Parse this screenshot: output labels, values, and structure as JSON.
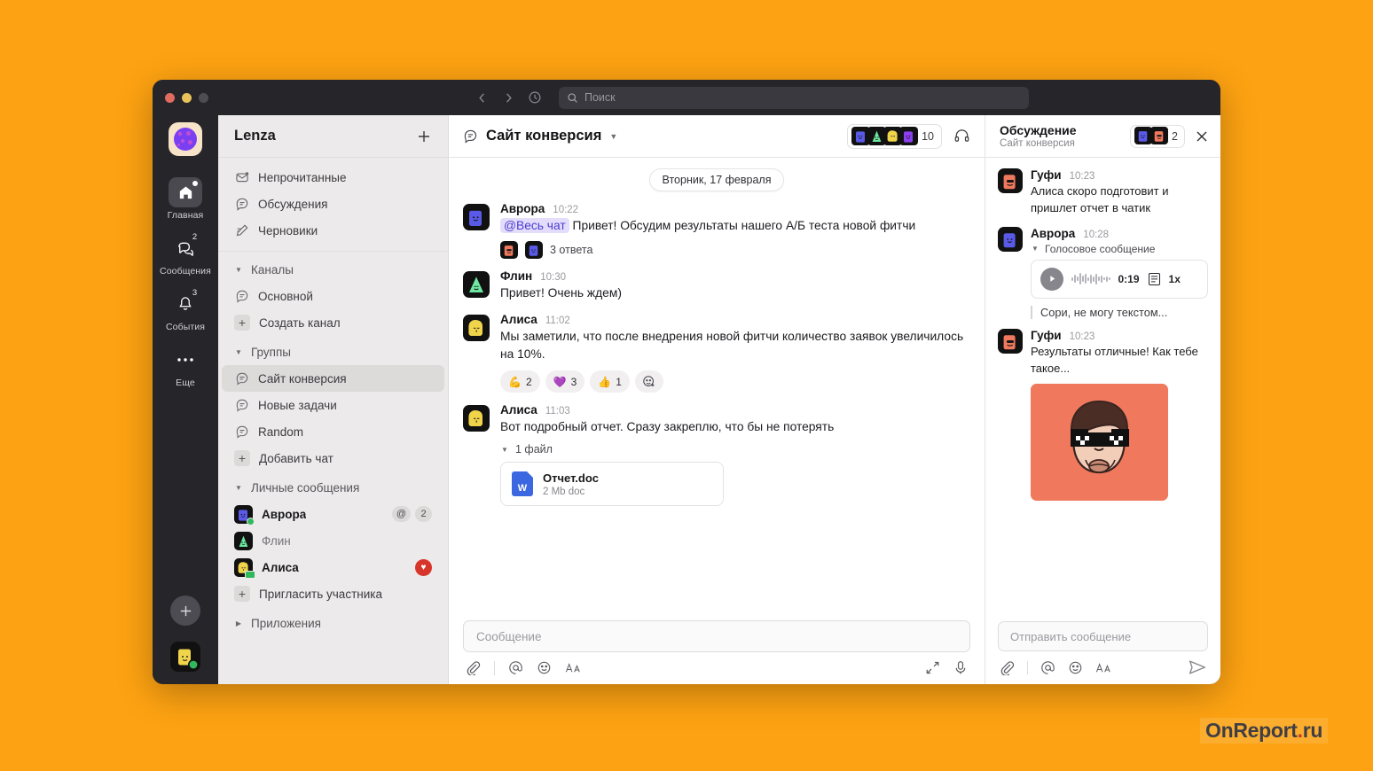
{
  "window": {
    "traffic_lights": [
      "close",
      "minimize",
      "maximize"
    ],
    "search": {
      "placeholder": "Поиск",
      "icon": "search-icon"
    },
    "nav": {
      "back": "chevron-left-icon",
      "forward": "chevron-right-icon",
      "history": "clock-icon"
    }
  },
  "rail": {
    "workspace_logo": "cookie-logo",
    "items": [
      {
        "label": "Главная",
        "icon": "home-icon",
        "badge": "",
        "active": true,
        "dot": true
      },
      {
        "label": "Сообщения",
        "icon": "chat-bubbles-icon",
        "badge": "2",
        "active": false,
        "dot": false
      },
      {
        "label": "События",
        "icon": "bell-icon",
        "badge": "3",
        "active": false,
        "dot": false
      },
      {
        "label": "Еще",
        "icon": "ellipsis-icon",
        "badge": "",
        "active": false,
        "dot": false
      }
    ],
    "add_button": "+",
    "me_avatar": "yellow-avatar"
  },
  "sidebar": {
    "title": "Lenza",
    "add_label": "+",
    "top_items": [
      {
        "label": "Непрочитанные",
        "icon": "envelope-icon"
      },
      {
        "label": "Обсуждения",
        "icon": "thread-icon"
      },
      {
        "label": "Черновики",
        "icon": "draft-pencil-icon"
      }
    ],
    "groups": [
      {
        "name": "Каналы",
        "expanded": true,
        "items": [
          {
            "label": "Основной",
            "icon": "channel-icon",
            "selected": false
          }
        ],
        "action": {
          "label": "Создать канал",
          "icon": "plus-box-icon"
        }
      },
      {
        "name": "Группы",
        "expanded": true,
        "items": [
          {
            "label": "Сайт конверсия",
            "icon": "channel-icon",
            "selected": true
          },
          {
            "label": "Новые задачи",
            "icon": "channel-icon",
            "selected": false
          },
          {
            "label": "Random",
            "icon": "channel-icon",
            "selected": false
          }
        ],
        "action": {
          "label": "Добавить чат",
          "icon": "plus-box-icon"
        }
      },
      {
        "name": "Личные сообщения",
        "expanded": true,
        "dms": [
          {
            "label": "Аврора",
            "unread": true,
            "mention": "@",
            "count": "2",
            "status": "online",
            "color": "#5a5ae8"
          },
          {
            "label": "Флин",
            "unread": false,
            "mention": "",
            "count": "",
            "status": "none",
            "color": "#6ee7a0"
          },
          {
            "label": "Алиса",
            "unread": true,
            "mention": "",
            "count": "",
            "status": "camera",
            "badge": "heart",
            "color": "#f0d44a"
          }
        ],
        "action": {
          "label": "Пригласить участника",
          "icon": "plus-box-icon"
        }
      }
    ],
    "apps": {
      "name": "Приложения",
      "expanded": false
    }
  },
  "channel": {
    "name": "Сайт конверсия",
    "icon": "channel-icon",
    "caret": "chevron-down-icon",
    "member_count": "10",
    "member_avatars": [
      "#5a5ae8",
      "#6ee7a0",
      "#f0d44a",
      "#8b3ff0"
    ],
    "headset": "headset-icon",
    "day_divider": "Вторник, 17 февраля",
    "messages": [
      {
        "author": "Аврора",
        "time": "10:22",
        "avatar_color": "#5a5ae8",
        "mention": "@Весь чат",
        "text": "Привет! Обсудим результаты нашего А/Б теста новой фитчи",
        "replies_label": "3 ответа",
        "reply_avatars": [
          "#f0795d",
          "#5a5ae8"
        ]
      },
      {
        "author": "Флин",
        "time": "10:30",
        "avatar_color": "#6ee7a0",
        "text": "Привет! Очень ждем)"
      },
      {
        "author": "Алиса",
        "time": "11:02",
        "avatar_color": "#f0d44a",
        "text": "Мы заметили, что после внедрения новой фитчи количество заявок увеличилось на 10%.",
        "reactions": [
          {
            "emoji": "💪",
            "count": "2"
          },
          {
            "emoji": "💜",
            "count": "3"
          },
          {
            "emoji": "👍",
            "count": "1"
          }
        ],
        "add_reaction": "add-reaction-icon"
      },
      {
        "author": "Алиса",
        "time": "11:03",
        "avatar_color": "#f0d44a",
        "text": "Вот подробный отчет. Сразу закреплю, что бы не потерять",
        "files_label": "1 файл",
        "file": {
          "name": "Отчет.doc",
          "meta": "2 Mb doc",
          "icon": "word-doc-icon"
        }
      }
    ],
    "composer": {
      "placeholder": "Сообщение",
      "tools": [
        "attach-icon",
        "mention-icon",
        "emoji-icon",
        "format-text-icon"
      ],
      "right_tools": [
        "expand-icon",
        "microphone-icon"
      ]
    }
  },
  "thread": {
    "title": "Обсуждение",
    "subtitle": "Сайт конверсия",
    "member_count": "2",
    "member_avatars": [
      "#5a5ae8",
      "#f0795d"
    ],
    "close": "close-icon",
    "messages": [
      {
        "author": "Гуфи",
        "time": "10:23",
        "avatar_color": "#f0795d",
        "text": "Алиса скоро подготовит и пришлет отчет в чатик"
      },
      {
        "author": "Аврора",
        "time": "10:28",
        "avatar_color": "#5a5ae8",
        "voice_label": "Голосовое сообщение",
        "voice": {
          "duration": "0:19",
          "rate": "1x",
          "play": "play-icon",
          "transcript": "transcript-icon"
        },
        "quote": "Сори, не могу текстом..."
      },
      {
        "author": "Гуфи",
        "time": "10:23",
        "avatar_color": "#f0795d",
        "text": "Результаты отличные! Как тебе такое...",
        "image": "meme-face-with-sunglasses"
      }
    ],
    "composer": {
      "placeholder": "Отправить сообщение",
      "tools": [
        "attach-icon",
        "mention-icon",
        "emoji-icon",
        "format-text-icon"
      ],
      "send": "send-icon"
    }
  },
  "watermark": {
    "text": "OnReport",
    "dot": ".",
    "suffix": "ru"
  },
  "colors": {
    "desktop_bg": "#FDA212",
    "window_chrome": "#26252a",
    "sidebar_bg": "#eceaea",
    "accent_mention": "#4b3bd0",
    "online": "#30b85c",
    "heart": "#d8352a"
  }
}
